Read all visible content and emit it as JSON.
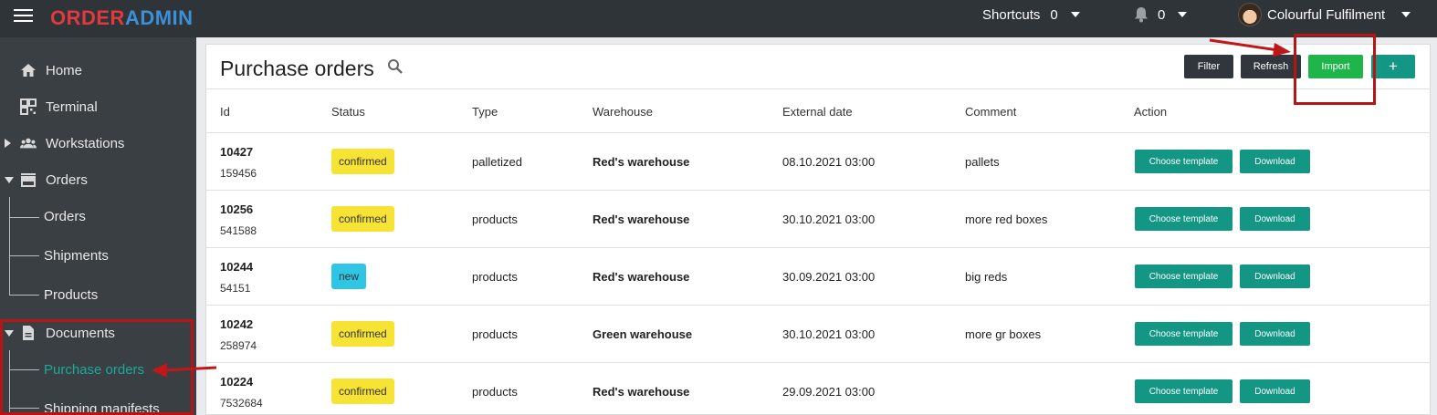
{
  "topbar": {
    "logo_part1": "ORDER",
    "logo_part2": "ADMIN",
    "shortcuts_label": "Shortcuts",
    "shortcuts_count": "0",
    "notifications_count": "0",
    "account_name": "Colourful Fulfilment"
  },
  "sidebar": {
    "home": "Home",
    "terminal": "Terminal",
    "workstations": "Workstations",
    "orders": "Orders",
    "orders_sub": [
      "Orders",
      "Shipments",
      "Products"
    ],
    "documents": "Documents",
    "documents_sub": [
      "Purchase orders",
      "Shipping manifests"
    ]
  },
  "page": {
    "title": "Purchase orders",
    "buttons": {
      "filter": "Filter",
      "refresh": "Refresh",
      "import": "Import",
      "add": "+"
    }
  },
  "table": {
    "headers": [
      "Id",
      "Status",
      "Type",
      "Warehouse",
      "External date",
      "Comment",
      "Action"
    ],
    "action_labels": {
      "choose_template": "Choose template",
      "download": "Download"
    },
    "rows": [
      {
        "id": "10427",
        "ext": "159456",
        "status": "confirmed",
        "type": "palletized",
        "warehouse": "Red's warehouse",
        "date": "08.10.2021 03:00",
        "comment": "pallets"
      },
      {
        "id": "10256",
        "ext": "541588",
        "status": "confirmed",
        "type": "products",
        "warehouse": "Red's warehouse",
        "date": "30.10.2021 03:00",
        "comment": "more red boxes"
      },
      {
        "id": "10244",
        "ext": "54151",
        "status": "new",
        "type": "products",
        "warehouse": "Red's warehouse",
        "date": "30.09.2021 03:00",
        "comment": "big reds"
      },
      {
        "id": "10242",
        "ext": "258974",
        "status": "confirmed",
        "type": "products",
        "warehouse": "Green warehouse",
        "date": "30.10.2021 03:00",
        "comment": "more gr boxes"
      },
      {
        "id": "10224",
        "ext": "7532684",
        "status": "confirmed",
        "type": "products",
        "warehouse": "Red's warehouse",
        "date": "29.09.2021 03:00",
        "comment": ""
      }
    ]
  },
  "colors": {
    "accent_teal": "#149684",
    "import_green": "#1fb54a",
    "badge_confirmed": "#f6e333",
    "badge_new": "#2fc6e6",
    "annotation_red": "#b51515"
  }
}
